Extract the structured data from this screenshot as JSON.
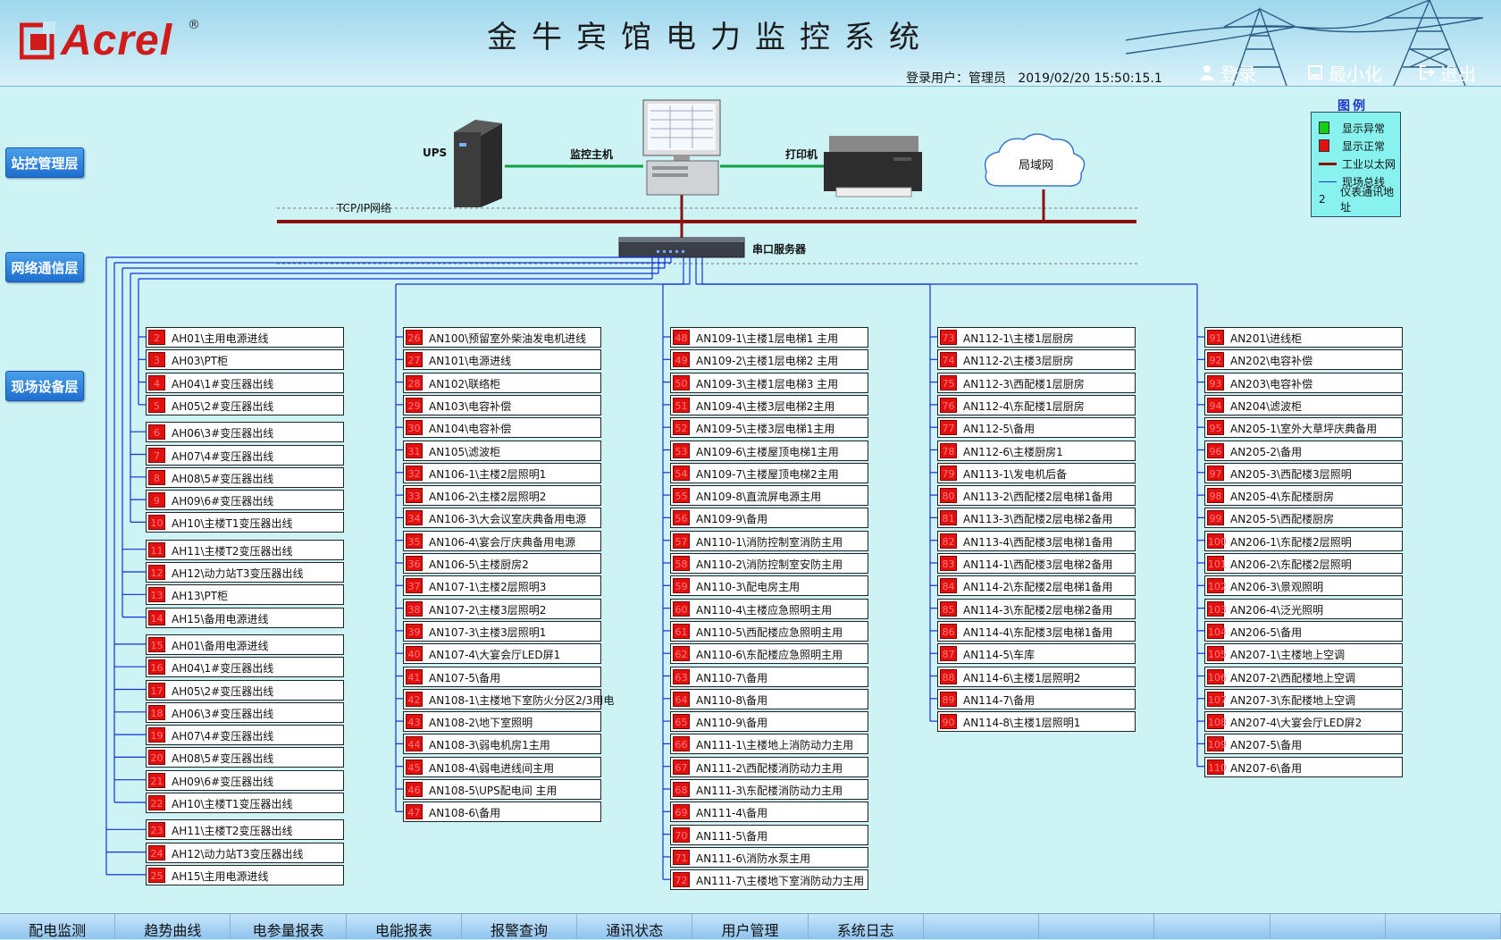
{
  "header": {
    "logo_text": "Acrel",
    "logo_reg": "®",
    "title": "金牛宾馆电力监控系统",
    "user_label": "登录用户：管理员",
    "datetime": "2019/02/20  15:50:15.1",
    "login": "登录",
    "minimize": "最小化",
    "exit": "退出"
  },
  "layers": {
    "station": "站控管理层",
    "network": "网络通信层",
    "field": "现场设备层"
  },
  "topology": {
    "ups": "UPS",
    "host": "监控主机",
    "printer": "打印机",
    "lan": "局域网",
    "tcpip": "TCP/IP网络",
    "serial_server": "串口服务器"
  },
  "legend": {
    "title": "图例",
    "items": [
      {
        "label": "显示异常",
        "color": "#10d010"
      },
      {
        "label": "显示正常",
        "color": "#e31010"
      },
      {
        "label": "工业以太网",
        "color": "#8a1010"
      },
      {
        "label": "现场总线",
        "color": "#1030e0"
      },
      {
        "label": "仪表通讯地址",
        "symbol": "2"
      }
    ]
  },
  "columns": [
    {
      "groups": [
        [
          {
            "addr": "2",
            "name": "AH01\\主用电源进线"
          },
          {
            "addr": "3",
            "name": "AH03\\PT柜"
          },
          {
            "addr": "4",
            "name": "AH04\\1#变压器出线"
          },
          {
            "addr": "5",
            "name": "AH05\\2#变压器出线"
          }
        ],
        [
          {
            "addr": "6",
            "name": "AH06\\3#变压器出线"
          },
          {
            "addr": "7",
            "name": "AH07\\4#变压器出线"
          },
          {
            "addr": "8",
            "name": "AH08\\5#变压器出线"
          },
          {
            "addr": "9",
            "name": "AH09\\6#变压器出线"
          },
          {
            "addr": "10",
            "name": "AH10\\主楼T1变压器出线"
          }
        ],
        [
          {
            "addr": "11",
            "name": "AH11\\主楼T2变压器出线"
          },
          {
            "addr": "12",
            "name": "AH12\\动力站T3变压器出线"
          },
          {
            "addr": "13",
            "name": "AH13\\PT柜"
          },
          {
            "addr": "14",
            "name": "AH15\\备用电源进线"
          }
        ],
        [
          {
            "addr": "15",
            "name": "AH01\\备用电源进线"
          },
          {
            "addr": "16",
            "name": "AH04\\1#变压器出线"
          },
          {
            "addr": "17",
            "name": "AH05\\2#变压器出线"
          },
          {
            "addr": "18",
            "name": "AH06\\3#变压器出线"
          },
          {
            "addr": "19",
            "name": "AH07\\4#变压器出线"
          },
          {
            "addr": "20",
            "name": "AH08\\5#变压器出线"
          },
          {
            "addr": "21",
            "name": "AH09\\6#变压器出线"
          },
          {
            "addr": "22",
            "name": "AH10\\主楼T1变压器出线"
          }
        ],
        [
          {
            "addr": "23",
            "name": "AH11\\主楼T2变压器出线"
          },
          {
            "addr": "24",
            "name": "AH12\\动力站T3变压器出线"
          },
          {
            "addr": "25",
            "name": "AH15\\主用电源进线"
          }
        ]
      ]
    },
    {
      "groups": [
        [
          {
            "addr": "26",
            "name": "AN100\\预留室外柴油发电机进线"
          },
          {
            "addr": "27",
            "name": "AN101\\电源进线"
          },
          {
            "addr": "28",
            "name": "AN102\\联络柜"
          },
          {
            "addr": "29",
            "name": "AN103\\电容补偿"
          },
          {
            "addr": "30",
            "name": "AN104\\电容补偿"
          },
          {
            "addr": "31",
            "name": "AN105\\滤波柜"
          },
          {
            "addr": "32",
            "name": "AN106-1\\主楼2层照明1"
          },
          {
            "addr": "33",
            "name": "AN106-2\\主楼2层照明2"
          },
          {
            "addr": "34",
            "name": "AN106-3\\大会议室庆典备用电源"
          },
          {
            "addr": "35",
            "name": "AN106-4\\宴会厅庆典备用电源"
          },
          {
            "addr": "36",
            "name": "AN106-5\\主楼厨房2"
          },
          {
            "addr": "37",
            "name": "AN107-1\\主楼2层照明3"
          },
          {
            "addr": "38",
            "name": "AN107-2\\主楼3层照明2"
          },
          {
            "addr": "39",
            "name": "AN107-3\\主楼3层照明1"
          },
          {
            "addr": "40",
            "name": "AN107-4\\大宴会厅LED屏1"
          },
          {
            "addr": "41",
            "name": "AN107-5\\备用"
          },
          {
            "addr": "42",
            "name": "AN108-1\\主楼地下室防火分区2/3用电"
          },
          {
            "addr": "43",
            "name": "AN108-2\\地下室照明"
          },
          {
            "addr": "44",
            "name": "AN108-3\\弱电机房1主用"
          },
          {
            "addr": "45",
            "name": "AN108-4\\弱电进线间主用"
          },
          {
            "addr": "46",
            "name": "AN108-5\\UPS配电间 主用"
          },
          {
            "addr": "47",
            "name": "AN108-6\\备用"
          }
        ]
      ]
    },
    {
      "groups": [
        [
          {
            "addr": "48",
            "name": "AN109-1\\主楼1层电梯1 主用"
          },
          {
            "addr": "49",
            "name": "AN109-2\\主楼1层电梯2 主用"
          },
          {
            "addr": "50",
            "name": "AN109-3\\主楼1层电梯3 主用"
          },
          {
            "addr": "51",
            "name": "AN109-4\\主楼3层电梯2主用"
          },
          {
            "addr": "52",
            "name": "AN109-5\\主楼3层电梯1主用"
          },
          {
            "addr": "53",
            "name": "AN109-6\\主楼屋顶电梯1主用"
          },
          {
            "addr": "54",
            "name": "AN109-7\\主楼屋顶电梯2主用"
          },
          {
            "addr": "55",
            "name": "AN109-8\\直流屏电源主用"
          },
          {
            "addr": "56",
            "name": "AN109-9\\备用"
          },
          {
            "addr": "57",
            "name": "AN110-1\\消防控制室消防主用"
          },
          {
            "addr": "58",
            "name": "AN110-2\\消防控制室安防主用"
          },
          {
            "addr": "59",
            "name": "AN110-3\\配电房主用"
          },
          {
            "addr": "60",
            "name": "AN110-4\\主楼应急照明主用"
          },
          {
            "addr": "61",
            "name": "AN110-5\\西配楼应急照明主用"
          },
          {
            "addr": "62",
            "name": "AN110-6\\东配楼应急照明主用"
          },
          {
            "addr": "63",
            "name": "AN110-7\\备用"
          },
          {
            "addr": "64",
            "name": "AN110-8\\备用"
          },
          {
            "addr": "65",
            "name": "AN110-9\\备用"
          },
          {
            "addr": "66",
            "name": "AN111-1\\主楼地上消防动力主用"
          },
          {
            "addr": "67",
            "name": "AN111-2\\西配楼消防动力主用"
          },
          {
            "addr": "68",
            "name": "AN111-3\\东配楼消防动力主用"
          },
          {
            "addr": "69",
            "name": "AN111-4\\备用"
          },
          {
            "addr": "70",
            "name": "AN111-5\\备用"
          },
          {
            "addr": "71",
            "name": "AN111-6\\消防水泵主用"
          },
          {
            "addr": "72",
            "name": "AN111-7\\主楼地下室消防动力主用"
          }
        ]
      ]
    },
    {
      "groups": [
        [
          {
            "addr": "73",
            "name": "AN112-1\\主楼1层厨房"
          },
          {
            "addr": "74",
            "name": "AN112-2\\主楼3层厨房"
          },
          {
            "addr": "75",
            "name": "AN112-3\\西配楼1层厨房"
          },
          {
            "addr": "76",
            "name": "AN112-4\\东配楼1层厨房"
          },
          {
            "addr": "77",
            "name": "AN112-5\\备用"
          },
          {
            "addr": "78",
            "name": "AN112-6\\主楼厨房1"
          },
          {
            "addr": "79",
            "name": "AN113-1\\发电机后备"
          },
          {
            "addr": "80",
            "name": "AN113-2\\西配楼2层电梯1备用"
          },
          {
            "addr": "81",
            "name": "AN113-3\\西配楼2层电梯2备用"
          },
          {
            "addr": "82",
            "name": "AN113-4\\西配楼3层电梯1备用"
          },
          {
            "addr": "83",
            "name": "AN114-1\\西配楼3层电梯2备用"
          },
          {
            "addr": "84",
            "name": "AN114-2\\东配楼2层电梯1备用"
          },
          {
            "addr": "85",
            "name": "AN114-3\\东配楼2层电梯2备用"
          },
          {
            "addr": "86",
            "name": "AN114-4\\东配楼3层电梯1备用"
          },
          {
            "addr": "87",
            "name": "AN114-5\\车库"
          },
          {
            "addr": "88",
            "name": "AN114-6\\主楼1层照明2"
          },
          {
            "addr": "89",
            "name": "AN114-7\\备用"
          },
          {
            "addr": "90",
            "name": "AN114-8\\主楼1层照明1"
          }
        ]
      ]
    },
    {
      "groups": [
        [
          {
            "addr": "91",
            "name": "AN201\\进线柜"
          },
          {
            "addr": "92",
            "name": "AN202\\电容补偿"
          },
          {
            "addr": "93",
            "name": "AN203\\电容补偿"
          },
          {
            "addr": "94",
            "name": "AN204\\滤波柜"
          },
          {
            "addr": "95",
            "name": "AN205-1\\室外大草坪庆典备用"
          },
          {
            "addr": "96",
            "name": "AN205-2\\备用"
          },
          {
            "addr": "97",
            "name": "AN205-3\\西配楼3层照明"
          },
          {
            "addr": "98",
            "name": "AN205-4\\东配楼厨房"
          },
          {
            "addr": "99",
            "name": "AN205-5\\西配楼厨房"
          },
          {
            "addr": "100",
            "name": "AN206-1\\东配楼2层照明"
          },
          {
            "addr": "101",
            "name": "AN206-2\\东配楼2层照明"
          },
          {
            "addr": "102",
            "name": "AN206-3\\景观照明"
          },
          {
            "addr": "103",
            "name": "AN206-4\\泛光照明"
          },
          {
            "addr": "104",
            "name": "AN206-5\\备用"
          },
          {
            "addr": "105",
            "name": "AN207-1\\主楼地上空调"
          },
          {
            "addr": "106",
            "name": "AN207-2\\西配楼地上空调"
          },
          {
            "addr": "107",
            "name": "AN207-3\\东配楼地上空调"
          },
          {
            "addr": "108",
            "name": "AN207-4\\大宴会厅LED屏2"
          },
          {
            "addr": "109",
            "name": "AN207-5\\备用"
          },
          {
            "addr": "110",
            "name": "AN207-6\\备用"
          }
        ]
      ]
    }
  ],
  "navbar": [
    "配电监测",
    "趋势曲线",
    "电参量报表",
    "电能报表",
    "报警查询",
    "通讯状态",
    "用户管理",
    "系统日志"
  ]
}
